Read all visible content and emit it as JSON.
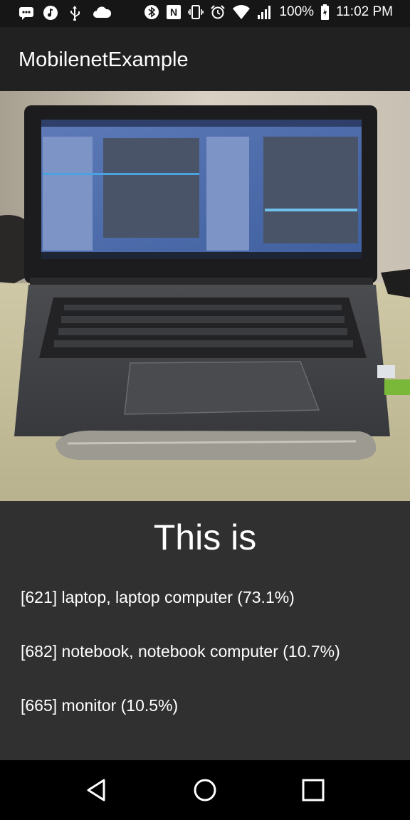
{
  "status_bar": {
    "battery": "100%",
    "time": "11:02 PM",
    "left_icons": [
      "message-icon",
      "music-icon",
      "usb-icon",
      "cloud-icon"
    ],
    "right_icons": [
      "bluetooth-icon",
      "nfc-icon",
      "vibrate-icon",
      "alarm-icon",
      "wifi-icon",
      "signal-icon",
      "battery-icon"
    ]
  },
  "app_bar": {
    "title": "MobilenetExample"
  },
  "main": {
    "heading": "This is",
    "results": [
      "[621] laptop, laptop computer (73.1%)",
      "[682] notebook, notebook computer (10.7%)",
      "[665] monitor (10.5%)"
    ]
  },
  "nav_bar": {
    "buttons": [
      "back-icon",
      "home-icon",
      "recents-icon"
    ]
  }
}
